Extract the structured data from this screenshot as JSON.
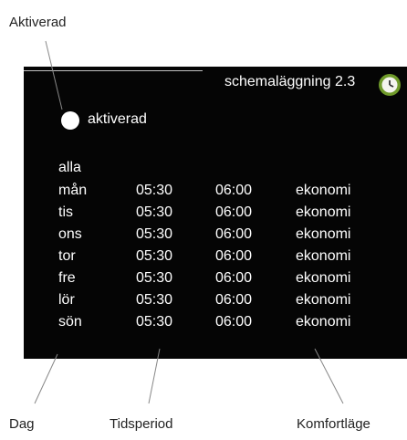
{
  "callouts": {
    "top": "Aktiverad",
    "bottom_left": "Dag",
    "bottom_middle": "Tidsperiod",
    "bottom_right": "Komfortläge"
  },
  "screen": {
    "title": "schemaläggning 2.3",
    "icon": "clock-icon",
    "radio_label": "aktiverad",
    "all_label": "alla",
    "rows": [
      {
        "day": "mån",
        "start": "05:30",
        "end": "06:00",
        "mode": "ekonomi"
      },
      {
        "day": "tis",
        "start": "05:30",
        "end": "06:00",
        "mode": "ekonomi"
      },
      {
        "day": "ons",
        "start": "05:30",
        "end": "06:00",
        "mode": "ekonomi"
      },
      {
        "day": "tor",
        "start": "05:30",
        "end": "06:00",
        "mode": "ekonomi"
      },
      {
        "day": "fre",
        "start": "05:30",
        "end": "06:00",
        "mode": "ekonomi"
      },
      {
        "day": "lör",
        "start": "05:30",
        "end": "06:00",
        "mode": "ekonomi"
      },
      {
        "day": "sön",
        "start": "05:30",
        "end": "06:00",
        "mode": "ekonomi"
      }
    ]
  },
  "colors": {
    "screen_bg": "#050505",
    "text": "#ffffff",
    "icon_green": "#6f9a2a"
  }
}
